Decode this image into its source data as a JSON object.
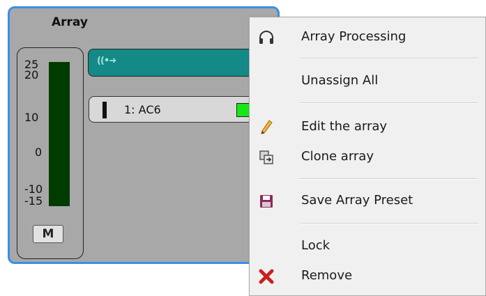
{
  "array": {
    "title": "Array",
    "meter": {
      "ticks": [
        "25",
        "20",
        "10",
        "0",
        "-10",
        "-15"
      ],
      "mute_label": "M"
    },
    "speaker": {
      "label": "1: AC6",
      "status_color": "#16e816"
    },
    "processing_icon": "speaker-waves-icon",
    "processing_color": "#138a86"
  },
  "menu": {
    "items": [
      {
        "label": "Array Processing",
        "icon": "headphones-icon"
      },
      {
        "label": "Unassign All",
        "icon": ""
      },
      {
        "label": "Edit the array",
        "icon": "pencil-icon"
      },
      {
        "label": "Clone array",
        "icon": "clone-icon"
      },
      {
        "label": "Save Array Preset",
        "icon": "floppy-disk-icon"
      },
      {
        "label": "Lock",
        "icon": ""
      },
      {
        "label": "Remove",
        "icon": "close-icon"
      }
    ]
  },
  "colors": {
    "panel_border": "#3a8fe6",
    "panel_bg": "#a8a8a8",
    "meter_fill": "#003b00",
    "remove_icon": "#c8201e",
    "save_icon": "#8a2b5a"
  }
}
